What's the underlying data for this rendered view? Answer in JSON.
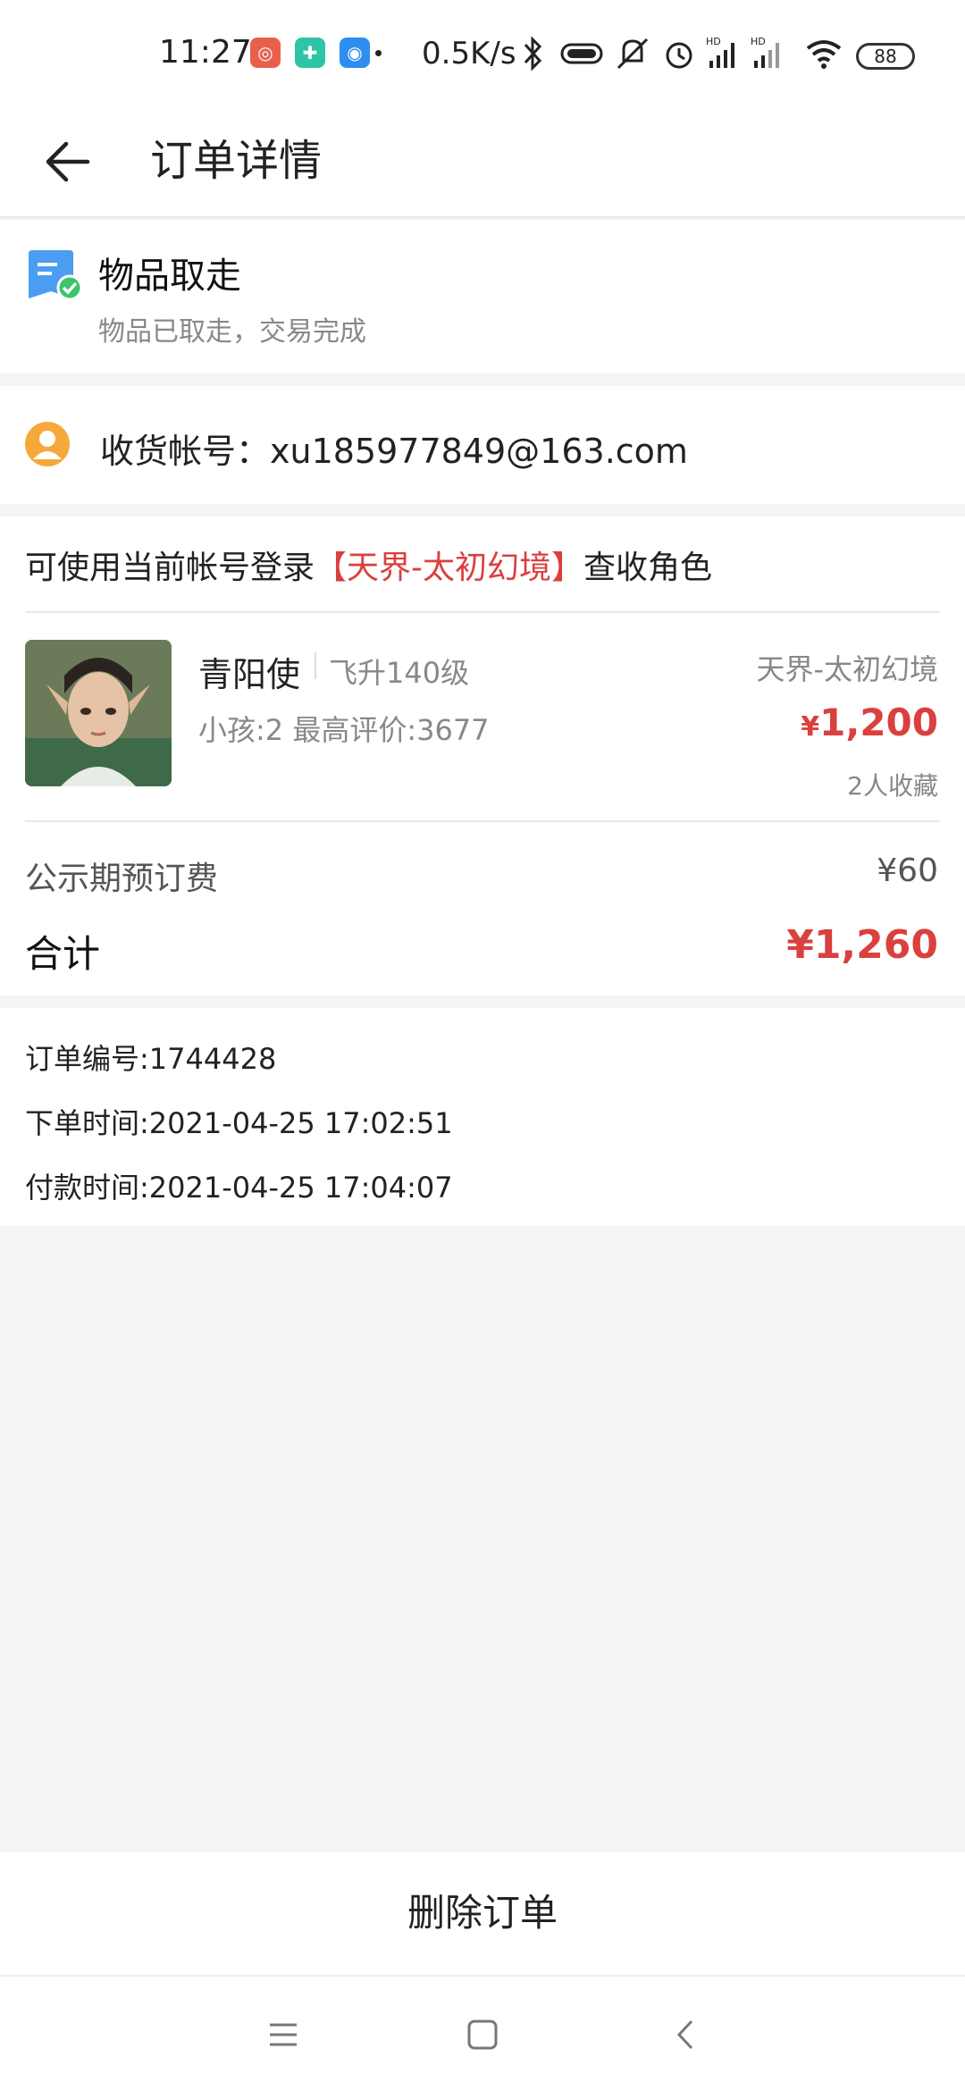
{
  "status_bar": {
    "time": "11:27",
    "net_speed": "0.5K/s",
    "battery": "88",
    "app_icons": [
      {
        "name": "netease-app-icon",
        "color": "#e8604c"
      },
      {
        "name": "shield-app-icon",
        "color": "#2ec4a6"
      },
      {
        "name": "browser-app-icon",
        "color": "#2e8ef0"
      }
    ]
  },
  "header": {
    "title": "订单详情",
    "back_icon": "arrow-left-icon"
  },
  "order_status": {
    "title": "物品取走",
    "description": "物品已取走，交易完成"
  },
  "account": {
    "text": "收货帐号：xu185977849@163.com"
  },
  "login_hint": {
    "prefix": "可使用当前帐号登录",
    "server": "【天界-太初幻境】",
    "suffix": "查收角色"
  },
  "item": {
    "name": "青阳使",
    "level": "飞升140级",
    "meta": "小孩:2 最高评价:3677",
    "server": "天界-太初幻境",
    "currency": "¥",
    "price": "1,200",
    "favorites": "2人收藏"
  },
  "fees": {
    "deposit_label": "公示期预订费",
    "deposit_value": "¥60",
    "total_label": "合计",
    "total_currency": "¥",
    "total_value": "1,260"
  },
  "order_info": {
    "order_no": "订单编号:1744428",
    "order_time": "下单时间:2021-04-25 17:02:51",
    "pay_time": "付款时间:2021-04-25 17:04:07"
  },
  "actions": {
    "delete_label": "删除订单"
  },
  "colors": {
    "accent_red": "#d9403e",
    "status_blue": "#4a9df0",
    "status_green": "#3cc46a",
    "avatar_orange": "#f4a93a"
  }
}
